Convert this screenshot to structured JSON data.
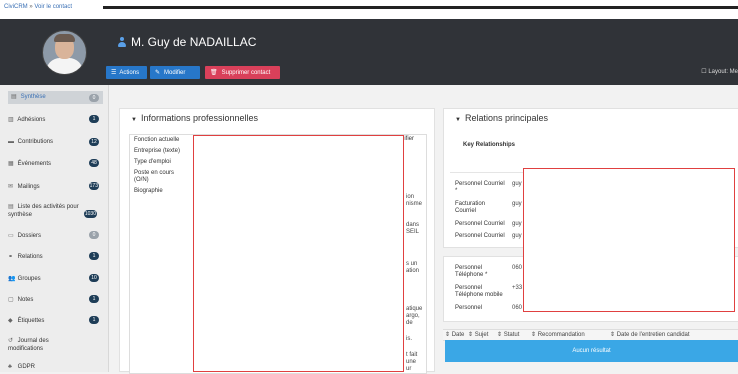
{
  "breadcrumb": {
    "root": "CiviCRM",
    "separator": "»",
    "current": "Voir le contact"
  },
  "contact": {
    "name": "M. Guy de NADAILLAC"
  },
  "actions": {
    "actions_label": "Actions",
    "modify_label": "Modifier",
    "delete_label": "Supprimer contact",
    "layout_label": "Layout: Me"
  },
  "colors": {
    "header": "#303338",
    "primary": "#2777c9",
    "danger": "#d9405a",
    "badge": "#1e3d57",
    "highlight": "#3aa7e6"
  },
  "sidebar": {
    "items": [
      {
        "label": "Synthèse",
        "count": "0",
        "icon": "summary-icon"
      },
      {
        "label": "Adhésions",
        "count": "1",
        "icon": "membership-icon"
      },
      {
        "label": "Contributions",
        "count": "12",
        "icon": "credit-card-icon"
      },
      {
        "label": "Événements",
        "count": "48",
        "icon": "calendar-icon"
      },
      {
        "label": "Mailings",
        "count": "173",
        "icon": "envelope-icon"
      },
      {
        "label": "Liste des activités pour",
        "label2": "synthèse",
        "count": "1030",
        "icon": "list-icon"
      },
      {
        "label": "Dossiers",
        "count": "0",
        "icon": "folder-icon"
      },
      {
        "label": "Relations",
        "count": "1",
        "icon": "handshake-icon"
      },
      {
        "label": "Groupes",
        "count": "10",
        "icon": "users-icon"
      },
      {
        "label": "Notes",
        "count": "1",
        "icon": "note-icon"
      },
      {
        "label": "Étiquettes",
        "count": "1",
        "icon": "tag-icon"
      },
      {
        "label": "Journal des",
        "label2": "modifications",
        "icon": "history-icon"
      },
      {
        "label": "GDPR",
        "icon": "gdpr-icon"
      }
    ]
  },
  "professional": {
    "title": "Informations professionnelles",
    "edit_fragment": "difier",
    "fields": [
      "Fonction actuelle",
      "Entreprise (texte)",
      "Type d'emploi",
      "Poste en cours",
      "(O/N)",
      "Biographie"
    ],
    "bio_fragments": [
      "ion",
      "nisme",
      "dans",
      "SEIL",
      "s un",
      "ation",
      "atique",
      "argo,",
      "de",
      "is.",
      "t fait",
      "une",
      "ur"
    ]
  },
  "relations": {
    "title": "Relations principales",
    "key_label": "Key Relationships",
    "email_rows": [
      {
        "label": "Personnel Courriel",
        "label2": "*",
        "value": "guy"
      },
      {
        "label": "Facturation",
        "label2": "Courriel",
        "value": "guy"
      },
      {
        "label": "Personnel Courriel",
        "value": "guy"
      },
      {
        "label": "Personnel Courriel",
        "value": "guy"
      }
    ],
    "phone_rows": [
      {
        "label": "Personnel",
        "label2": "Téléphone *",
        "value": "060"
      },
      {
        "label": "Personnel",
        "label2": "Téléphone mobile",
        "value": "+33"
      },
      {
        "label": "Personnel",
        "value": "060"
      }
    ]
  },
  "grid": {
    "columns": [
      "Date",
      "Sujet",
      "Statut",
      "Recommandation",
      "Date de l'entretien candidat"
    ],
    "empty_message": "Aucun résultat"
  }
}
